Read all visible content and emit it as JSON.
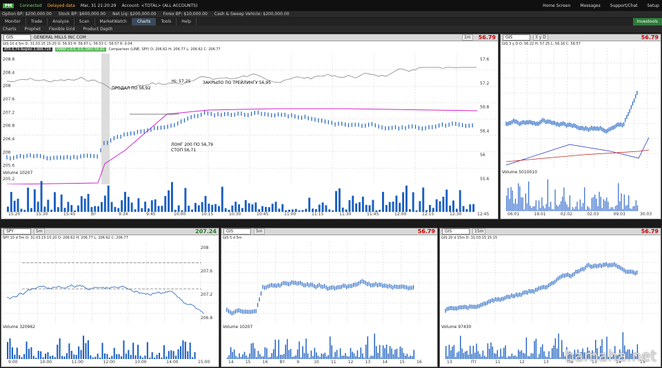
{
  "topbar": {
    "badge": "PM",
    "connected": "Connected",
    "delayed": "Delayed data",
    "time": "Mar, 31 21:20:29",
    "account": "Account: <TOTAL> (ALL ACCOUNTS)",
    "home": "Home Screen",
    "messages": "Messages",
    "support": "Support/Chat",
    "setup": "Setup"
  },
  "account_bar": {
    "option_bp": "Option BP: $200,000.00",
    "stock_bp": "Stock BP: $600,000.00",
    "net_liq": "Net Liq: $200,000.00",
    "forex_bp": "Forex BP: $10,000.00",
    "cash": "Cash & Sweep Vehicle: $200,000.00"
  },
  "nav": {
    "tabs": [
      "Monitor",
      "Trade",
      "Analyze",
      "Scan",
      "MarketWatch",
      "Charts",
      "Tools",
      "Help"
    ],
    "active": "Charts",
    "investools": "Investools"
  },
  "subnav": [
    "Charts",
    "Prophet",
    "Flexible Grid",
    "Product Depth"
  ],
  "main": {
    "symbol": "GIS",
    "title": "GENERAL MILLS INC COM",
    "price": "56.79",
    "period": "1m",
    "info": "GIS 10 d 5m  D: 31.03.15 15:20  O: 56.93  H: 56.67  L: 56.53  C: 56.57  R: 0.04",
    "ind": "ATR 8,74  AvgVol 3,988,728",
    "vwap": "VWAP (-0.0, 0.0, DAY)  56.82",
    "comp": "Comparison (LINE, SPY)  O: 206.62  H: 206.77  L: 206.62  C: 206.77",
    "ann1": "ПРОДАЛ ПО 56,92",
    "ann2": "ЗАКРЫЛО ПО ТРЕЙЛИНГУ 56,95",
    "ann3": "ЛОНГ 200 ПО 56,79",
    "ann4": "СТОП 56,71",
    "hi": "Hi: 57.25",
    "volume": "Volume  10207",
    "xlabels": [
      "15:20",
      "15:30",
      "15:45",
      "Вт",
      "9:34",
      "9:45",
      "10:00",
      "10:15",
      "10:30",
      "10:45",
      "11:00",
      "11:15",
      "11:30",
      "11:45",
      "12:00",
      "12:15",
      "12:30",
      "12:45"
    ],
    "ylabels": [
      "208.8",
      "208.4",
      "208",
      "207.6",
      "207.2",
      "206.8",
      "206.4",
      "206",
      "205.6",
      "205.2"
    ],
    "yright": [
      "57.6",
      "57.2",
      "56.8",
      "56.4",
      "56",
      "55.6"
    ]
  },
  "right": {
    "symbol": "GIS",
    "period": "3 y D",
    "price": "56.79",
    "info": "GIS 3 y D  O: 56.22  H: 57.25  L: 56.16  C: 56.57",
    "xlabels": [
      "06.01",
      "19.01",
      "02.02",
      "02.03",
      "09.03",
      "30.03"
    ],
    "volume": "Volume  5010010"
  },
  "spy": {
    "symbol": "SPY",
    "price": "207.24",
    "period": "5m",
    "info": "SPY 10 d 5m  D: 31.03.15 15:20  O: 206.62  H: 206.77  L: 206.62  C: 206.77",
    "volume": "Volume  320962",
    "xlabels": [
      "9:00",
      "10:00",
      "11:00",
      "12:00",
      "13:00",
      "14:00",
      "15:00"
    ],
    "ylabels": [
      "208",
      "207.6",
      "207.2",
      "206.8"
    ]
  },
  "gis5": {
    "symbol": "GIS",
    "price": "56.79",
    "period": "5m",
    "info": "GIS 5 d 5m",
    "volume": "Volume  10207",
    "xlabels": [
      "14",
      "15",
      "16",
      "Вт",
      "9",
      "10",
      "11",
      "12",
      "13",
      "14",
      "15",
      "16"
    ]
  },
  "gis15": {
    "symbol": "GIS",
    "price": "56.79",
    "period": "15m",
    "info": "GIS 20 d 15m  D: 31.03.15 15:15",
    "volume": "Volume  97430",
    "xlabels": [
      "13",
      "Пт",
      "11",
      "12",
      "13",
      "Пн",
      "13",
      "14",
      "15"
    ]
  },
  "watermark": "hamaha.net"
}
